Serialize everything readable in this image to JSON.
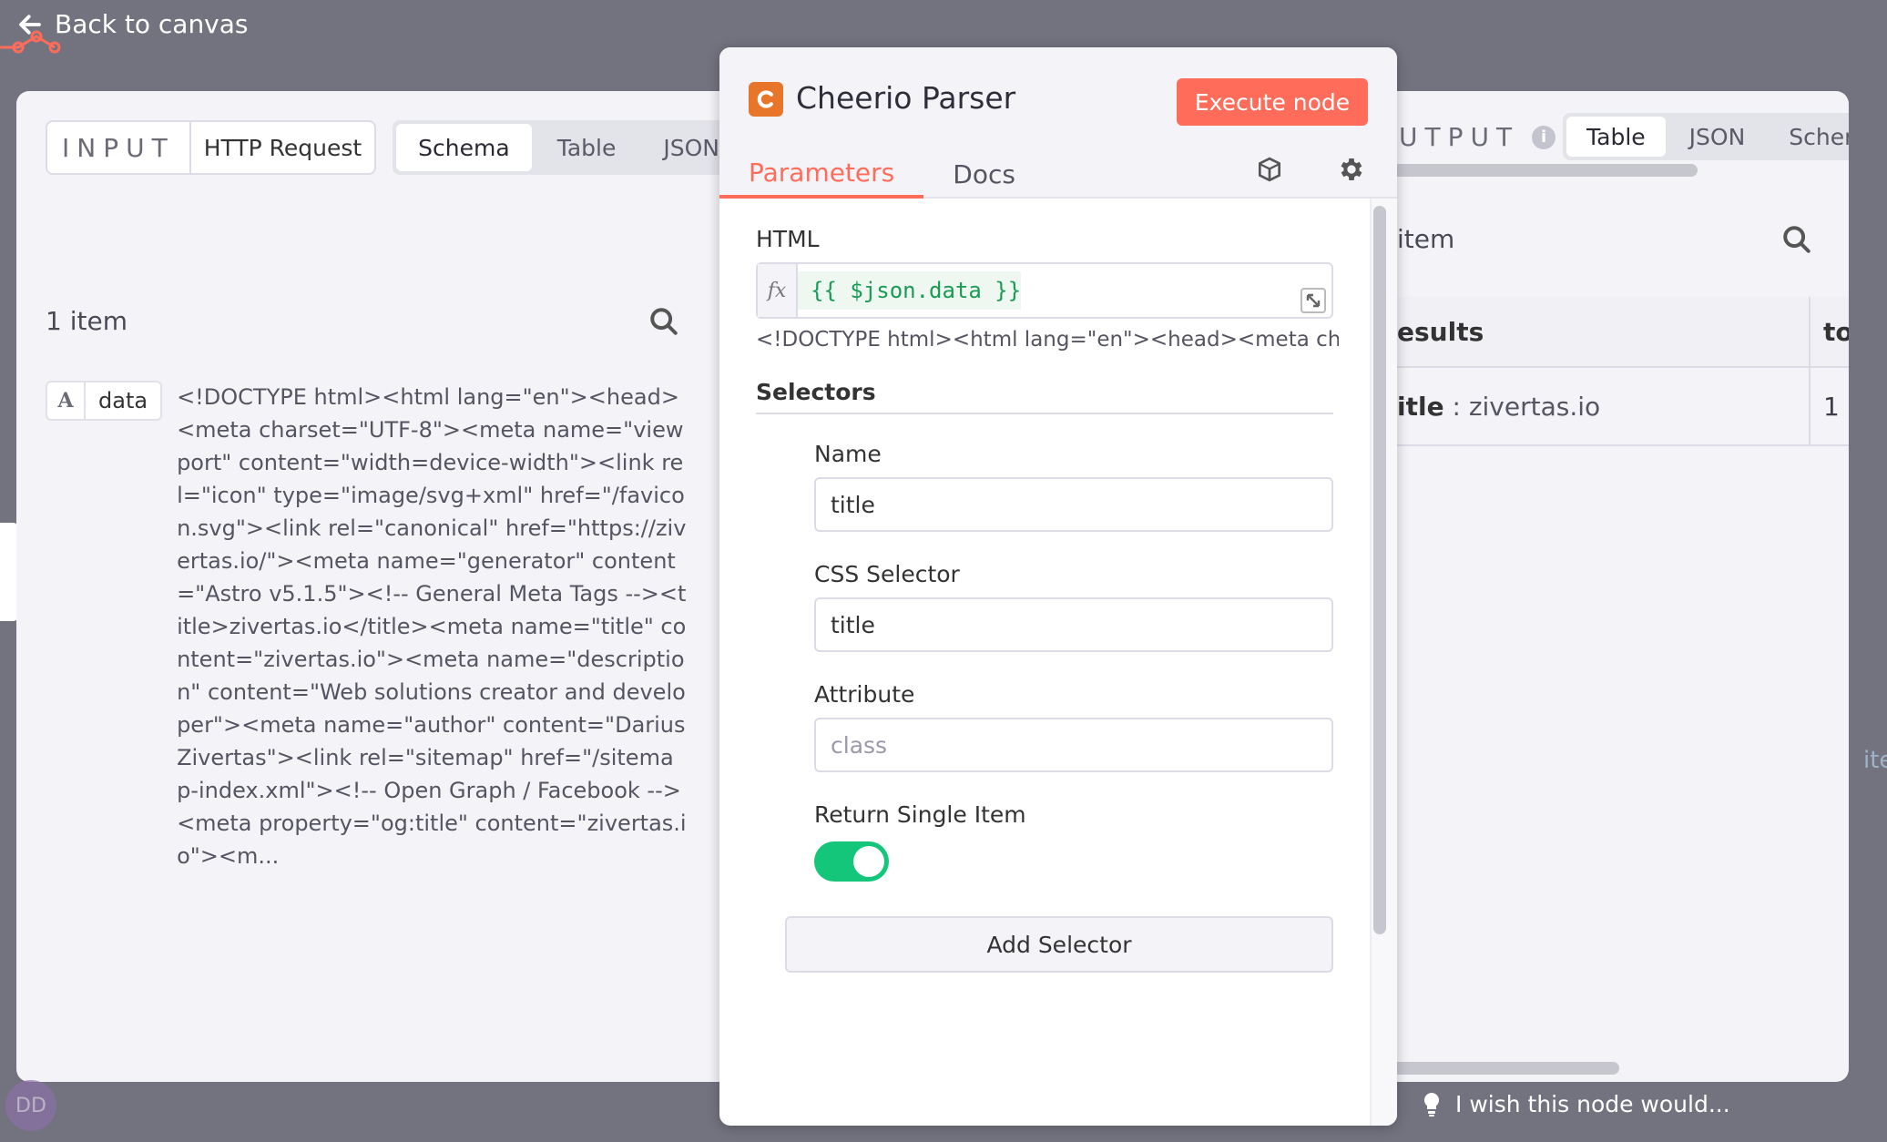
{
  "back": {
    "label": "Back to canvas"
  },
  "input": {
    "label": "INPUT",
    "source": "HTTP Request",
    "tabs": [
      "Schema",
      "Table",
      "JSON"
    ],
    "active_tab": "Schema",
    "count": "1 item",
    "field_type": "A",
    "field_key": "data",
    "field_value": "<!DOCTYPE html><html lang=\"en\"><head><meta charset=\"UTF-8\"><meta name=\"viewport\" content=\"width=device-width\"><link rel=\"icon\" type=\"image/svg+xml\" href=\"/favicon.svg\"><link rel=\"canonical\" href=\"https://zivertas.io/\"><meta name=\"generator\" content=\"Astro v5.1.5\"><!-- General Meta Tags --><title>zivertas.io</title><meta name=\"title\" content=\"zivertas.io\"><meta name=\"description\" content=\"Web solutions creator and developer\"><meta name=\"author\" content=\"Darius Zivertas\"><link rel=\"sitemap\" href=\"/sitemap-index.xml\"><!-- Open Graph / Facebook --><meta property=\"og:title\" content=\"zivertas.io\"><m..."
  },
  "node": {
    "title": "Cheerio Parser",
    "execute_label": "Execute node",
    "tabs": {
      "parameters": "Parameters",
      "docs": "Docs"
    },
    "html_label": "HTML",
    "html_fx": "fx",
    "html_expression": "{{ $json.data }}",
    "html_preview": "<!DOCTYPE html><html lang=\"en\"><head><meta chars...",
    "selectors_title": "Selectors",
    "name_label": "Name",
    "name_value": "title",
    "css_label": "CSS Selector",
    "css_value": "title",
    "attribute_label": "Attribute",
    "attribute_placeholder": "class",
    "single_label": "Return Single Item",
    "single_enabled": true,
    "add_selector_label": "Add Selector"
  },
  "output": {
    "label": "UTPUT",
    "info": "i",
    "tabs": [
      "Table",
      "JSON",
      "Schem"
    ],
    "active_tab": "Table",
    "count": "item",
    "col1_header": "esults",
    "col2_header": "to",
    "row_key": "itle",
    "row_sep": " : ",
    "row_value": "zivertas.io",
    "row_col2": "1"
  },
  "feedback": {
    "label": "I wish this node would..."
  },
  "avatar": {
    "initials": "DD"
  },
  "edge_text": "ite",
  "colors": {
    "accent": "#ff6d5a",
    "toggle_on": "#14c67a",
    "backdrop": "#73737f"
  }
}
